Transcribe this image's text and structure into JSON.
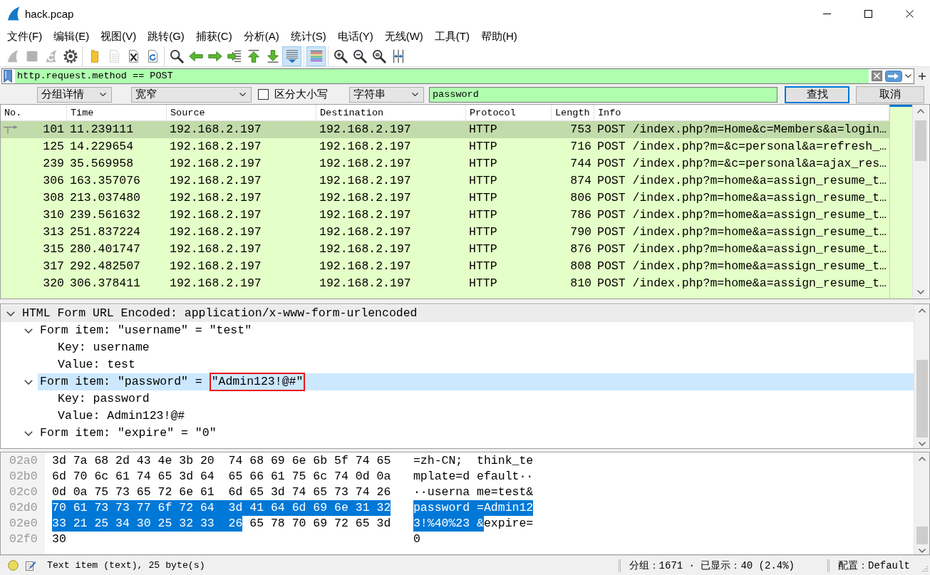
{
  "window": {
    "title": "hack.pcap"
  },
  "menu": [
    "文件(F)",
    "编辑(E)",
    "视图(V)",
    "跳转(G)",
    "捕获(C)",
    "分析(A)",
    "统计(S)",
    "电话(Y)",
    "无线(W)",
    "工具(T)",
    "帮助(H)"
  ],
  "toolbar": [
    [
      {
        "kind": "start",
        "disabled": true,
        "pressed": false
      },
      {
        "kind": "stop",
        "disabled": true,
        "pressed": false
      },
      {
        "kind": "restart",
        "disabled": true,
        "pressed": false
      },
      {
        "kind": "options",
        "disabled": false,
        "pressed": false
      }
    ],
    [
      {
        "kind": "open",
        "disabled": false,
        "pressed": false
      },
      {
        "kind": "save",
        "disabled": true,
        "pressed": false
      },
      {
        "kind": "close",
        "disabled": false,
        "pressed": false
      },
      {
        "kind": "reload",
        "disabled": false,
        "pressed": false
      }
    ],
    [
      {
        "kind": "find",
        "disabled": false,
        "pressed": false
      },
      {
        "kind": "back",
        "disabled": false,
        "pressed": false
      },
      {
        "kind": "forward",
        "disabled": false,
        "pressed": false
      },
      {
        "kind": "goto",
        "disabled": false,
        "pressed": false
      },
      {
        "kind": "first",
        "disabled": false,
        "pressed": false
      },
      {
        "kind": "last",
        "disabled": false,
        "pressed": false
      },
      {
        "kind": "autoscroll",
        "disabled": false,
        "pressed": true
      }
    ],
    [
      {
        "kind": "colorize",
        "disabled": false,
        "pressed": true
      }
    ],
    [
      {
        "kind": "zoom_in",
        "disabled": false,
        "pressed": false
      },
      {
        "kind": "zoom_out",
        "disabled": false,
        "pressed": false
      },
      {
        "kind": "zoom_reset",
        "disabled": false,
        "pressed": false
      },
      {
        "kind": "resize_columns",
        "disabled": false,
        "pressed": false
      }
    ]
  ],
  "display_filter": {
    "value": "http.request.method == POST",
    "valid": true
  },
  "find_bar": {
    "search_in": "分组详情",
    "char_width": "宽窄",
    "case_sensitive": {
      "label": "区分大小写",
      "checked": false
    },
    "search_type": "字符串",
    "query": {
      "value": "password",
      "valid": true
    },
    "buttons": [
      {
        "label": "查找",
        "default": true
      },
      {
        "label": "取消",
        "default": false
      }
    ]
  },
  "packet_list": {
    "columns": [
      "No.",
      "Time",
      "Source",
      "Destination",
      "Protocol",
      "Length",
      "Info"
    ],
    "rows": [
      {
        "cells": [
          "101",
          "11.239111",
          "192.168.2.197",
          "192.168.2.197",
          "HTTP",
          "753",
          "POST /index.php?m=Home&c=Members&a=login…"
        ],
        "selected": true,
        "marker": true
      },
      {
        "cells": [
          "125",
          "14.229654",
          "192.168.2.197",
          "192.168.2.197",
          "HTTP",
          "716",
          "POST /index.php?m=&c=personal&a=refresh_…"
        ],
        "selected": false,
        "marker": false
      },
      {
        "cells": [
          "239",
          "35.569958",
          "192.168.2.197",
          "192.168.2.197",
          "HTTP",
          "744",
          "POST /index.php?m=&c=personal&a=ajax_res…"
        ],
        "selected": false,
        "marker": false
      },
      {
        "cells": [
          "306",
          "163.357076",
          "192.168.2.197",
          "192.168.2.197",
          "HTTP",
          "874",
          "POST /index.php?m=home&a=assign_resume_t…"
        ],
        "selected": false,
        "marker": false
      },
      {
        "cells": [
          "308",
          "213.037480",
          "192.168.2.197",
          "192.168.2.197",
          "HTTP",
          "806",
          "POST /index.php?m=home&a=assign_resume_t…"
        ],
        "selected": false,
        "marker": false
      },
      {
        "cells": [
          "310",
          "239.561632",
          "192.168.2.197",
          "192.168.2.197",
          "HTTP",
          "786",
          "POST /index.php?m=home&a=assign_resume_t…"
        ],
        "selected": false,
        "marker": false
      },
      {
        "cells": [
          "313",
          "251.837224",
          "192.168.2.197",
          "192.168.2.197",
          "HTTP",
          "790",
          "POST /index.php?m=home&a=assign_resume_t…"
        ],
        "selected": false,
        "marker": false
      },
      {
        "cells": [
          "315",
          "280.401747",
          "192.168.2.197",
          "192.168.2.197",
          "HTTP",
          "876",
          "POST /index.php?m=home&a=assign_resume_t…"
        ],
        "selected": false,
        "marker": false
      },
      {
        "cells": [
          "317",
          "292.482507",
          "192.168.2.197",
          "192.168.2.197",
          "HTTP",
          "808",
          "POST /index.php?m=home&a=assign_resume_t…"
        ],
        "selected": false,
        "marker": false
      },
      {
        "cells": [
          "320",
          "306.378411",
          "192.168.2.197",
          "192.168.2.197",
          "HTTP",
          "810",
          "POST /index.php?m=home&a=assign_resume_t…"
        ],
        "selected": false,
        "marker": false
      }
    ]
  },
  "details": [
    {
      "text": "HTML Form URL Encoded: application/x-www-form-urlencoded",
      "expanded": true,
      "selected": false,
      "hovered": true,
      "children": [
        {
          "text": "Form item: \"username\" = \"test\"",
          "expanded": true,
          "selected": false,
          "hovered": false,
          "children": [
            {
              "text": "Key: username",
              "selected": false,
              "hovered": false
            },
            {
              "text": "Value: test",
              "selected": false,
              "hovered": false
            }
          ]
        },
        {
          "text": "Form item: \"password\" = ",
          "boxed": "\"Admin123!@#\"",
          "expanded": true,
          "selected": true,
          "hovered": false,
          "children": [
            {
              "text": "Key: password",
              "selected": false,
              "hovered": false
            },
            {
              "text": "Value: Admin123!@#",
              "selected": false,
              "hovered": false
            }
          ]
        },
        {
          "text": "Form item: \"expire\" = \"0\"",
          "expanded": true,
          "selected": false,
          "hovered": false
        }
      ]
    }
  ],
  "bytes_pane": {
    "rows": [
      {
        "offset": "02a0",
        "hex": [
          [
            {
              "text": "3d 7a 68 2d 43 4e 3b 20",
              "selected": false
            }
          ],
          [
            {
              "text": "74 68 69 6e 6b 5f 74 65",
              "selected": false
            }
          ]
        ],
        "ascii": [
          [
            {
              "text": "=zh-CN; ",
              "selected": false
            }
          ],
          [
            {
              "text": "think_te",
              "selected": false
            }
          ]
        ]
      },
      {
        "offset": "02b0",
        "hex": [
          [
            {
              "text": "6d 70 6c 61 74 65 3d 64",
              "selected": false
            }
          ],
          [
            {
              "text": "65 66 61 75 6c 74 0d 0a",
              "selected": false
            }
          ]
        ],
        "ascii": [
          [
            {
              "text": "mplate=d",
              "selected": false
            }
          ],
          [
            {
              "text": "efault··",
              "selected": false
            }
          ]
        ]
      },
      {
        "offset": "02c0",
        "hex": [
          [
            {
              "text": "0d 0a 75 73 65 72 6e 61",
              "selected": false
            }
          ],
          [
            {
              "text": "6d 65 3d 74 65 73 74 26",
              "selected": false
            }
          ]
        ],
        "ascii": [
          [
            {
              "text": "··userna",
              "selected": false
            }
          ],
          [
            {
              "text": "me=test&",
              "selected": false
            }
          ]
        ]
      },
      {
        "offset": "02d0",
        "hex": [
          [
            {
              "text": "70 61 73 73 77 6f 72 64",
              "selected": true
            }
          ],
          [
            {
              "text": "3d 41 64 6d 69 6e 31 32",
              "selected": true
            }
          ]
        ],
        "ascii": [
          [
            {
              "text": "password",
              "selected": true
            }
          ],
          [
            {
              "text": "=Admin12",
              "selected": true
            }
          ]
        ]
      },
      {
        "offset": "02e0",
        "hex": [
          [
            {
              "text": "33 21 25 34 30 25 32 33",
              "selected": true
            }
          ],
          [
            {
              "text": "26",
              "selected": true
            },
            {
              "text": "65 78 70 69 72 65 3d",
              "selected": false
            }
          ]
        ],
        "ascii": [
          [
            {
              "text": "3!%40%23",
              "selected": true
            }
          ],
          [
            {
              "text": "&",
              "selected": true
            },
            {
              "text": "expire=",
              "selected": false
            }
          ]
        ]
      },
      {
        "offset": "02f0",
        "hex": [
          [
            {
              "text": "30",
              "selected": false
            }
          ]
        ],
        "ascii": [
          [
            {
              "text": "0",
              "selected": false
            }
          ]
        ]
      }
    ]
  },
  "status_bar": {
    "message": "Text item (text), 25 byte(s)",
    "packets": "分组：1671 · 已显示：40 (2.4%)",
    "profile": "配置：Default"
  }
}
